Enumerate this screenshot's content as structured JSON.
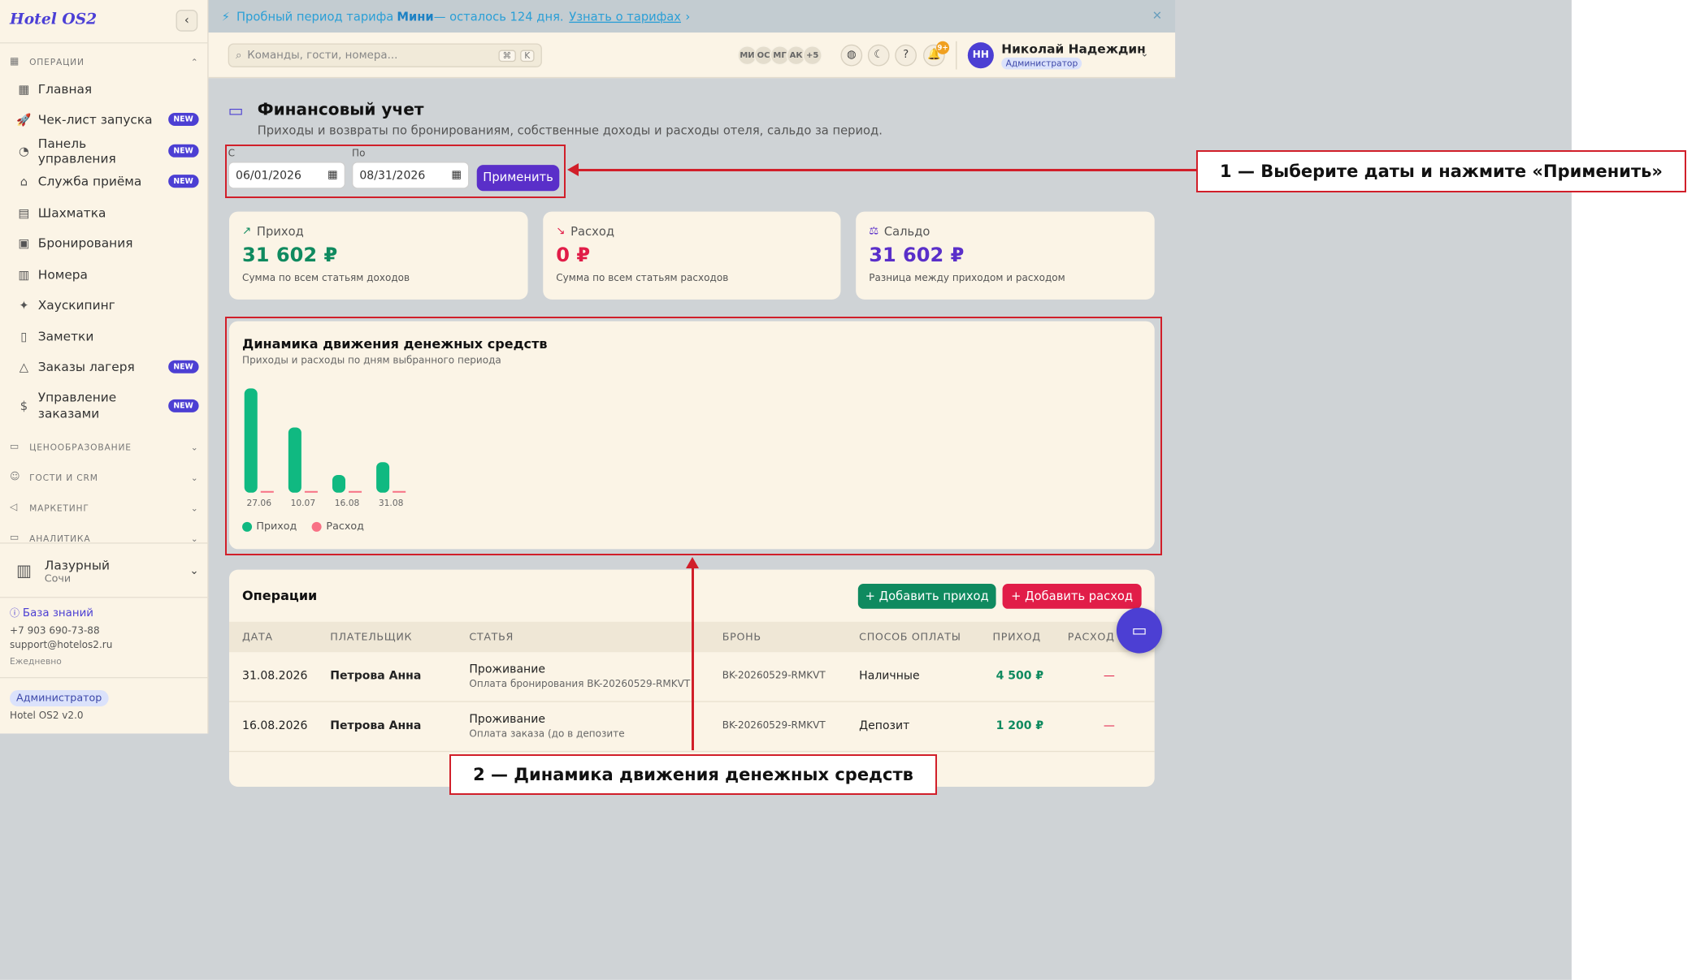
{
  "app": {
    "logo": "Hotel OS2",
    "collapse_icon": "chevron-left-icon"
  },
  "sidebar": {
    "section_operations": "ОПЕРАЦИИ",
    "items": [
      {
        "label": "Главная",
        "icon": "grid-icon",
        "badge": ""
      },
      {
        "label": "Чек-лист запуска",
        "icon": "rocket-icon",
        "badge": "NEW"
      },
      {
        "label": "Панель управления",
        "icon": "gauge-icon",
        "badge": "NEW"
      },
      {
        "label": "Служба приёма",
        "icon": "bell-desk-icon",
        "badge": "NEW"
      },
      {
        "label": "Шахматка",
        "icon": "table-icon",
        "badge": ""
      },
      {
        "label": "Бронирования",
        "icon": "clipboard-icon",
        "badge": ""
      },
      {
        "label": "Номера",
        "icon": "building-icon",
        "badge": ""
      },
      {
        "label": "Хаускипинг",
        "icon": "sparkle-icon",
        "badge": ""
      },
      {
        "label": "Заметки",
        "icon": "note-icon",
        "badge": ""
      },
      {
        "label": "Заказы лагеря",
        "icon": "tent-icon",
        "badge": "NEW"
      },
      {
        "label": "Управление заказами",
        "icon": "dollar-doc-icon",
        "badge": "NEW"
      }
    ],
    "sections": [
      "ЦЕНООБРАЗОВАНИЕ",
      "ГОСТИ И CRM",
      "МАРКЕТИНГ",
      "АНАЛИТИКА"
    ],
    "hotel": {
      "name": "Лазурный",
      "city": "Сочи"
    },
    "knowledge_base": "База знаний",
    "phone": "+7 903 690-73-88",
    "email": "support@hotelos2.ru",
    "schedule": "Ежедневно",
    "role": "Администратор",
    "version": "Hotel OS2 v2.0"
  },
  "promo": {
    "prefix": "Пробный период тарифа ",
    "plan": "Мини",
    "suffix": " — осталось 124 дня.",
    "link": "Узнать о тарифах"
  },
  "topbar": {
    "search_placeholder": "Команды, гости, номера...",
    "kbd1": "⌘",
    "kbd2": "K",
    "avatars": [
      "МИ",
      "ОС",
      "МГ",
      "АК",
      "+5"
    ],
    "notif_count": "9+",
    "user_initials": "НН",
    "user_name": "Николай Надеждин",
    "user_role": "Администратор"
  },
  "page": {
    "title": "Финансовый учет",
    "subtitle": "Приходы и возвраты по бронированиям, собственные доходы и расходы отеля, сальдо за период.",
    "from_label": "С",
    "from_value": "06/01/2026",
    "to_label": "По",
    "to_value": "08/31/2026",
    "apply": "Применить"
  },
  "stats": [
    {
      "label": "Приход",
      "value": "31 602 ₽",
      "note": "Сумма по всем статьям доходов",
      "color": "#0f8a5f"
    },
    {
      "label": "Расход",
      "value": "0 ₽",
      "note": "Сумма по всем статьям расходов",
      "color": "#e11d48"
    },
    {
      "label": "Сальдо",
      "value": "31 602 ₽",
      "note": "Разница между приходом и расходом",
      "color": "#5a2fc9"
    }
  ],
  "chart_data": {
    "type": "bar",
    "title": "Динамика движения денежных средств",
    "subtitle": "Приходы и расходы по дням выбранного периода",
    "categories": [
      "27.06",
      "10.07",
      "16.08",
      "31.08"
    ],
    "series": [
      {
        "name": "Приход",
        "color": "#10b981",
        "values": [
          14700,
          9200,
          2500,
          4300
        ]
      },
      {
        "name": "Расход",
        "color": "#f87185",
        "values": [
          0,
          0,
          0,
          0
        ]
      }
    ],
    "ylim": [
      0,
      15000
    ],
    "grid": false,
    "legend": "bottom-left"
  },
  "operations": {
    "title": "Операции",
    "add_income": "Добавить приход",
    "add_expense": "Добавить расход",
    "columns": [
      "ДАТА",
      "ПЛАТЕЛЬЩИК",
      "СТАТЬЯ",
      "БРОНЬ",
      "СПОСОБ ОПЛАТЫ",
      "ПРИХОД",
      "РАСХОД"
    ],
    "rows": [
      {
        "date": "31.08.2026",
        "payer": "Петрова Анна",
        "item": "Проживание",
        "item_note": "Оплата бронирования BK-20260529-RMKVT",
        "booking": "BK-20260529-RMKVT",
        "method": "Наличные",
        "income": "4 500 ₽",
        "expense": "—"
      },
      {
        "date": "16.08.2026",
        "payer": "Петрова Анна",
        "item": "Проживание",
        "item_note": "Оплата заказа (до в депозите",
        "booking": "BK-20260529-RMKVT",
        "method": "Депозит",
        "income": "1 200 ₽",
        "expense": "—"
      }
    ]
  },
  "annotations": {
    "label1": "1 — Выберите даты и нажмите «Применить»",
    "label2": "2 — Динамика движения денежных средств",
    "color": "#d11f2a"
  }
}
